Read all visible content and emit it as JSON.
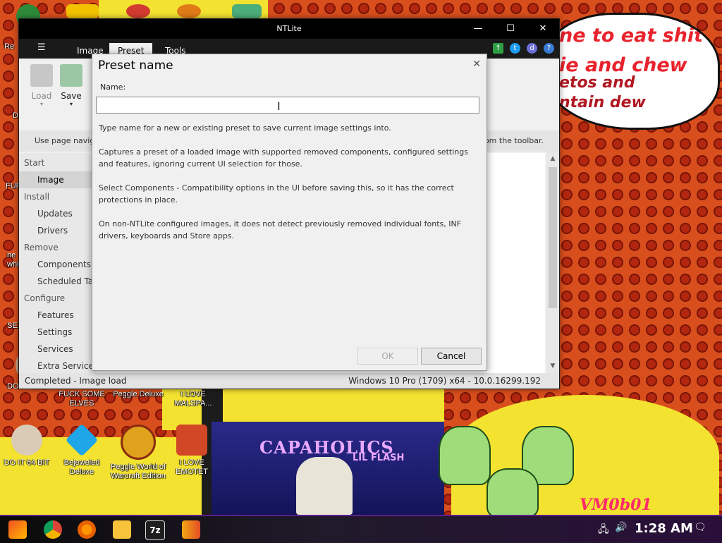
{
  "app": {
    "title": "NTLite",
    "tabs": [
      {
        "label": "Image",
        "active": false
      },
      {
        "label": "Preset",
        "active": true
      },
      {
        "label": "Tools",
        "active": false
      }
    ],
    "ribbon": {
      "load_label": "Load",
      "save_label": "Save"
    },
    "hint_left": "Use page navig",
    "hint_right": "om the toolbar.",
    "nav": [
      {
        "label": "Start",
        "type": "group"
      },
      {
        "label": "Image",
        "type": "sub",
        "selected": true
      },
      {
        "label": "Install",
        "type": "group"
      },
      {
        "label": "Updates",
        "type": "sub"
      },
      {
        "label": "Drivers",
        "type": "sub"
      },
      {
        "label": "Remove",
        "type": "group"
      },
      {
        "label": "Components",
        "type": "sub"
      },
      {
        "label": "Scheduled Tas",
        "type": "sub"
      },
      {
        "label": "Configure",
        "type": "group"
      },
      {
        "label": "Features",
        "type": "sub"
      },
      {
        "label": "Settings",
        "type": "sub"
      },
      {
        "label": "Services",
        "type": "sub"
      },
      {
        "label": "Extra Service",
        "type": "sub"
      }
    ],
    "status_left": "Completed - Image load",
    "status_right": "Windows 10 Pro (1709) x64 - 10.0.16299.192",
    "window_controls": {
      "minimize": "—",
      "maximize": "☐",
      "close": "✕"
    },
    "menu_glyph": "☰"
  },
  "dialog": {
    "title": "Preset name",
    "close_glyph": "✕",
    "name_label": "Name:",
    "name_value": "",
    "paragraphs": [
      "Type name for a new or existing preset to save current image settings into.",
      "Captures a preset of a loaded image with supported removed components, configured settings and features, ignoring current UI selection for those.",
      "Select Components - Compatibility options in the UI before saving this, so it has the correct protections in place.",
      "On non-NTLite configured images, it does not detect previously removed individual fonts, INF drivers, keyboards and Store apps."
    ],
    "ok_label": "OK",
    "cancel_label": "Cancel",
    "ok_enabled": false
  },
  "desktop": {
    "bubble_lines": [
      "ne to eat shit",
      "ie and chew",
      "etos and",
      "ntain dew"
    ],
    "icons_row1": [
      "DO IT LIVE",
      "FUCK SOME ELVES",
      "Peggle Deluxe",
      "I LOVE MALSPA..."
    ],
    "icons_row2": [
      "DO IT 64 BIT",
      "Bejeweled Deluxe",
      "Peggle World of Warcraft Edition",
      "I LOVE EMOTET"
    ],
    "left_edge_labels": [
      "Re",
      "D",
      "FUR",
      "ne whi",
      "SEX"
    ],
    "album_title": "CAPAHOLICS",
    "album_sub": "LIL FLASH",
    "watermark": "VM0b01"
  },
  "taskbar": {
    "clock": "1:28 AM",
    "icons": [
      "start-icon",
      "chrome-icon",
      "firefox-icon",
      "file-explorer-icon",
      "7zip-icon",
      "ntlite-icon"
    ],
    "zip_label": "7z"
  },
  "colors": {
    "titlebar": "#000000",
    "menubar": "#1a1a1a",
    "dialog_bg": "#f0f0f0",
    "bubble_text": "#e8232d",
    "taskbar_accent": "#5b1f8a"
  }
}
